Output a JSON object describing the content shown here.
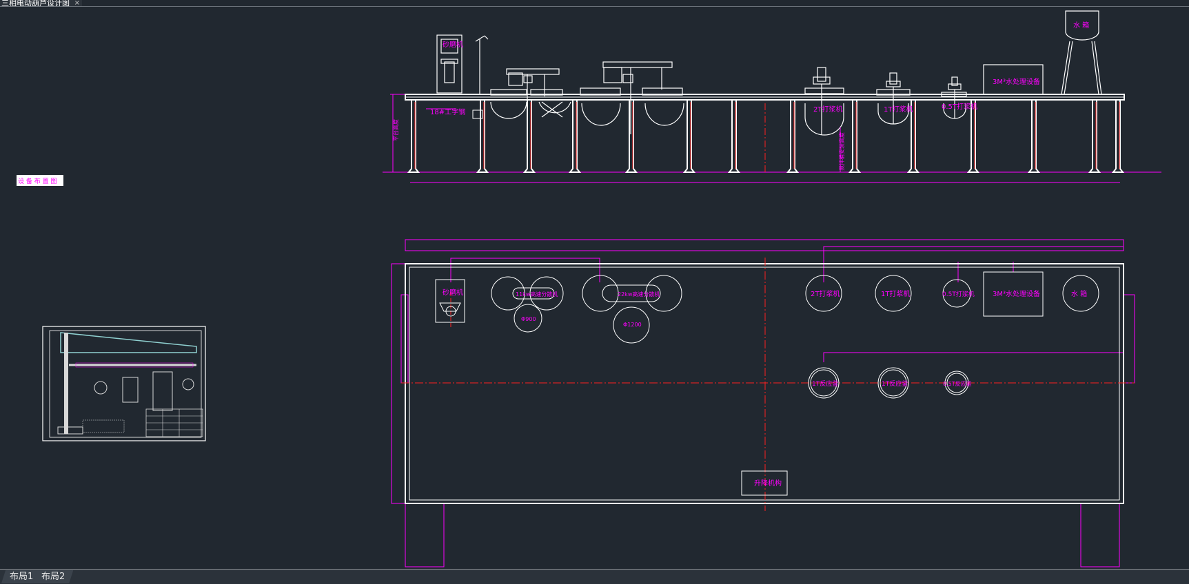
{
  "document_tab": {
    "title": "三相电动葫芦设计图",
    "close_glyph": "×"
  },
  "layout_tabs": [
    "布局1",
    "布局2"
  ],
  "elevation_labels": {
    "grinder": "砂磨机",
    "i_beam": "18#工字钢",
    "pump_2t": "2T打浆机",
    "pump_1t": "1T打浆机",
    "pump_05t": "0.5T打浆机",
    "water_treatment": "3M³水处理设备",
    "water_tank": "水 箱",
    "height_dim_left": "平台高度",
    "height_dim_mid": "搅拌桶安装高度"
  },
  "plan_labels": {
    "grinder": "砂磨机",
    "disperser_a": "11kw高速分散机",
    "disperser_b": "22kw高速分散机",
    "tank_a": "Φ900",
    "tank_b": "Φ1200",
    "pump_2t": "2T打浆机",
    "pump_1t": "1T打浆机",
    "pump_05t": "0.5T打浆机",
    "water_treatment": "3M³水处理设备",
    "water_tank": "水 箱",
    "reactor_1t_a": "1T反应釜",
    "reactor_1t_b": "1T反应釜",
    "reactor_05t": "0.5T反应釜",
    "lift": "升降机构"
  },
  "legend_box": "设 备 布 置 图",
  "palette": {
    "background": "#212830",
    "drawing_lines": "#ffffff",
    "annotation": "#ff00ff",
    "centerline": "#ff2020"
  }
}
